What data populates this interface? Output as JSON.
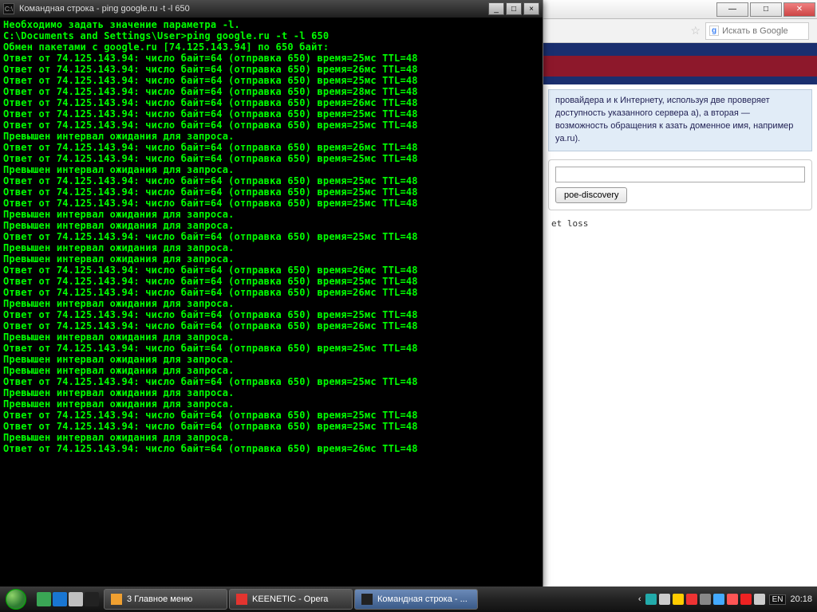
{
  "cmd": {
    "title": "Командная строка - ping google.ru -t -l 650",
    "lines": [
      "Необходимо задать значение параметра -l.",
      "",
      "C:\\Documents and Settings\\User>ping google.ru -t -l 650",
      "",
      "Обмен пакетами с google.ru [74.125.143.94] по 650 байт:",
      "",
      "Ответ от 74.125.143.94: число байт=64 (отправка 650) время=25мс TTL=48",
      "Ответ от 74.125.143.94: число байт=64 (отправка 650) время=26мс TTL=48",
      "Ответ от 74.125.143.94: число байт=64 (отправка 650) время=25мс TTL=48",
      "Ответ от 74.125.143.94: число байт=64 (отправка 650) время=28мс TTL=48",
      "Ответ от 74.125.143.94: число байт=64 (отправка 650) время=26мс TTL=48",
      "Ответ от 74.125.143.94: число байт=64 (отправка 650) время=25мс TTL=48",
      "Ответ от 74.125.143.94: число байт=64 (отправка 650) время=25мс TTL=48",
      "Превышен интервал ожидания для запроса.",
      "Ответ от 74.125.143.94: число байт=64 (отправка 650) время=26мс TTL=48",
      "Ответ от 74.125.143.94: число байт=64 (отправка 650) время=25мс TTL=48",
      "Превышен интервал ожидания для запроса.",
      "Ответ от 74.125.143.94: число байт=64 (отправка 650) время=25мс TTL=48",
      "Ответ от 74.125.143.94: число байт=64 (отправка 650) время=25мс TTL=48",
      "Ответ от 74.125.143.94: число байт=64 (отправка 650) время=25мс TTL=48",
      "Превышен интервал ожидания для запроса.",
      "Превышен интервал ожидания для запроса.",
      "Ответ от 74.125.143.94: число байт=64 (отправка 650) время=25мс TTL=48",
      "Превышен интервал ожидания для запроса.",
      "Превышен интервал ожидания для запроса.",
      "Ответ от 74.125.143.94: число байт=64 (отправка 650) время=26мс TTL=48",
      "Ответ от 74.125.143.94: число байт=64 (отправка 650) время=25мс TTL=48",
      "Ответ от 74.125.143.94: число байт=64 (отправка 650) время=26мс TTL=48",
      "Превышен интервал ожидания для запроса.",
      "Ответ от 74.125.143.94: число байт=64 (отправка 650) время=25мс TTL=48",
      "Ответ от 74.125.143.94: число байт=64 (отправка 650) время=26мс TTL=48",
      "Превышен интервал ожидания для запроса.",
      "Ответ от 74.125.143.94: число байт=64 (отправка 650) время=25мс TTL=48",
      "Превышен интервал ожидания для запроса.",
      "Превышен интервал ожидания для запроса.",
      "Ответ от 74.125.143.94: число байт=64 (отправка 650) время=25мс TTL=48",
      "Превышен интервал ожидания для запроса.",
      "Превышен интервал ожидания для запроса.",
      "Ответ от 74.125.143.94: число байт=64 (отправка 650) время=25мс TTL=48",
      "Ответ от 74.125.143.94: число байт=64 (отправка 650) время=25мс TTL=48",
      "Превышен интервал ожидания для запроса.",
      "Ответ от 74.125.143.94: число байт=64 (отправка 650) время=26мс TTL=48",
      ""
    ]
  },
  "browser": {
    "search_placeholder": "Искать в Google",
    "panel_text": "провайдера и к Интернету, используя две проверяет доступность указанного сервера а), а вторая — возможность обращения к азать доменное имя, например ya.ru).",
    "btn_label": "poe-discovery",
    "mono_text": "et loss"
  },
  "taskbar": {
    "tasks": [
      {
        "label": "3 Главное меню",
        "icon_color": "#f0a030"
      },
      {
        "label": "KEENETIC - Opera",
        "icon_color": "#e3342f"
      },
      {
        "label": "Командная строка - ...",
        "icon_color": "#222",
        "active": true
      }
    ],
    "lang": "EN",
    "clock": "20:18",
    "ql_icons": [
      "#3aa655",
      "#1976d2",
      "#c0c0c0",
      "#222"
    ],
    "tray_icons": [
      "#2aa",
      "#ccc",
      "#fc0",
      "#e33",
      "#888",
      "#4af",
      "#f55",
      "#e22",
      "#ccc"
    ]
  }
}
